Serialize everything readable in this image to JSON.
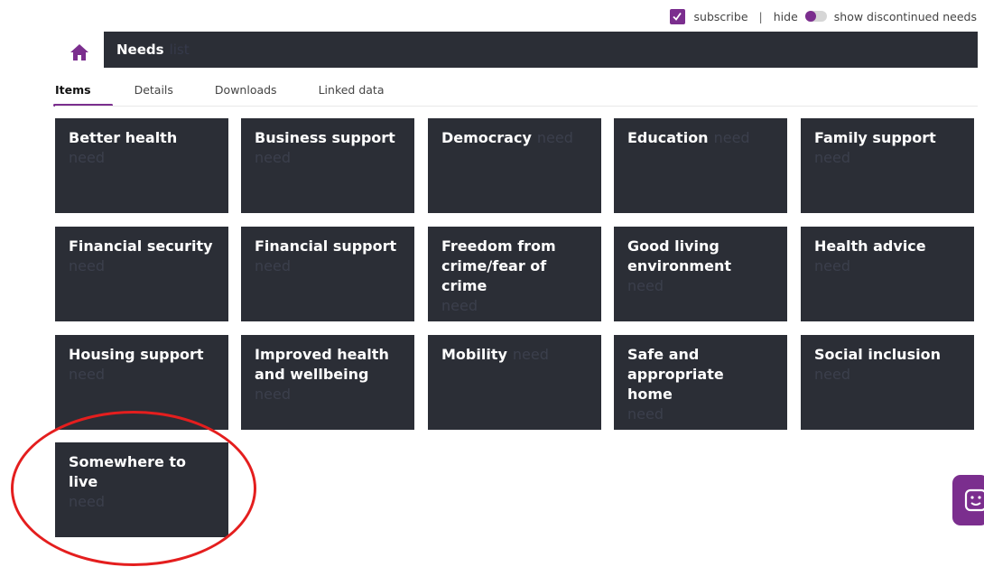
{
  "topbar": {
    "subscribe_label": "subscribe",
    "separator": "|",
    "hide_label": "hide",
    "discontinued_label": "show discontinued needs"
  },
  "header": {
    "title": "Needs",
    "subtitle": "list"
  },
  "tabs": [
    {
      "label": "Items",
      "active": true
    },
    {
      "label": "Details"
    },
    {
      "label": "Downloads"
    },
    {
      "label": "Linked data"
    }
  ],
  "tiles": [
    {
      "name": "Better health",
      "type": "need"
    },
    {
      "name": "Business support",
      "type": "need"
    },
    {
      "name": "Democracy",
      "type": "need"
    },
    {
      "name": "Education",
      "type": "need"
    },
    {
      "name": "Family support",
      "type": "need"
    },
    {
      "name": "Financial security",
      "type": "need"
    },
    {
      "name": "Financial support",
      "type": "need"
    },
    {
      "name": "Freedom from crime/fear of crime",
      "type": "need"
    },
    {
      "name": "Good living environment",
      "type": "need"
    },
    {
      "name": "Health advice",
      "type": "need"
    },
    {
      "name": "Housing support",
      "type": "need"
    },
    {
      "name": "Improved health and wellbeing",
      "type": "need"
    },
    {
      "name": "Mobility",
      "type": "need"
    },
    {
      "name": "Safe and appropriate home",
      "type": "need"
    },
    {
      "name": "Social inclusion",
      "type": "need"
    },
    {
      "name": "Somewhere to live",
      "type": "need"
    }
  ],
  "colors": {
    "accent": "#7b2e8e",
    "tile_bg": "#2b2e36",
    "annotation": "#e41e1e"
  }
}
